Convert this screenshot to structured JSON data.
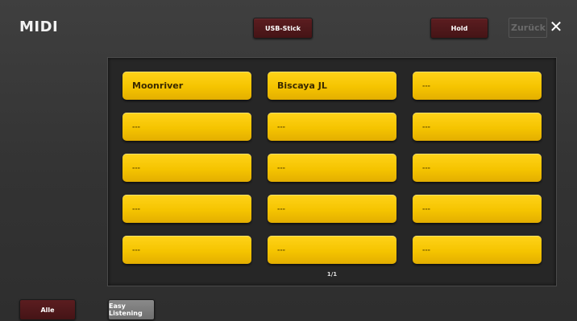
{
  "header": {
    "title": "MIDI",
    "usb_label": "USB-Stick",
    "hold_label": "Hold",
    "back_label": "Zurück",
    "close_icon": "close-icon"
  },
  "songs": [
    "Moonriver",
    "Biscaya JL",
    "---",
    "---",
    "---",
    "---",
    "---",
    "---",
    "---",
    "---",
    "---",
    "---",
    "---",
    "---",
    "---"
  ],
  "pager": "1/1",
  "footer": {
    "all_label": "Alle",
    "category_label": "Easy Listening"
  },
  "colors": {
    "song_button": "#f5c400",
    "red_button": "#5b1d20",
    "background": "#3a3a3a"
  }
}
